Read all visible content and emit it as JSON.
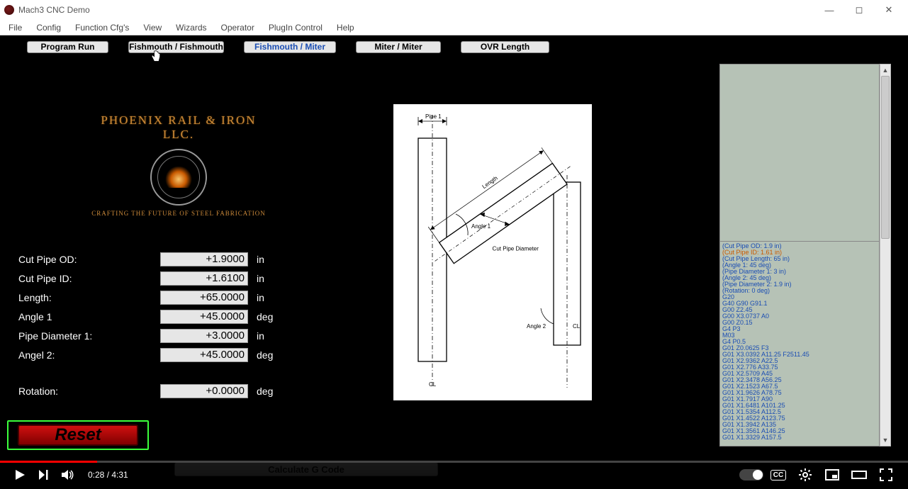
{
  "window": {
    "title": "Mach3 CNC  Demo"
  },
  "menu": [
    "File",
    "Config",
    "Function Cfg's",
    "View",
    "Wizards",
    "Operator",
    "PlugIn Control",
    "Help"
  ],
  "tabs": {
    "t1": "Program Run",
    "t2": "Fishmouth / Fishmouth",
    "t3": "Fishmouth / Miter",
    "t4": "Miter / Miter",
    "t5": "OVR Length"
  },
  "logo": {
    "arc": "PHOENIX RAIL & IRON LLC.",
    "sub": "CRAFTING THE FUTURE OF STEEL FABRICATION"
  },
  "params": {
    "cut_pipe_od": {
      "label": "Cut Pipe OD:",
      "value": "+1.9000",
      "unit": "in"
    },
    "cut_pipe_id": {
      "label": "Cut Pipe ID:",
      "value": "+1.6100",
      "unit": "in"
    },
    "length": {
      "label": "Length:",
      "value": "+65.0000",
      "unit": "in"
    },
    "angle1": {
      "label": "Angle 1",
      "value": "+45.0000",
      "unit": "deg"
    },
    "pipe_dia1": {
      "label": "Pipe Diameter 1:",
      "value": "+3.0000",
      "unit": "in"
    },
    "angle2": {
      "label": "Angel 2:",
      "value": "+45.0000",
      "unit": "deg"
    },
    "rotation": {
      "label": "Rotation:",
      "value": "+0.0000",
      "unit": "deg"
    }
  },
  "buttons": {
    "reset": "Reset",
    "calc": "Calculate G Code"
  },
  "diagram": {
    "pipe1": "Pipe 1",
    "angle1": "Angle 1",
    "length": "Length",
    "cpd": "Cut Pipe Diameter",
    "angle2": "Angle 2",
    "cl1": "CL",
    "cl2": "CL"
  },
  "gcode": [
    "(Cut Pipe OD: 1.9 in)",
    "(Cut Pipe ID: 1.61 in)",
    "(Cut Pipe Length: 65 in)",
    "(Angle 1: 45 deg)",
    "(Pipe Diameter 1: 3 in)",
    "(Angle 2: 45 deg)",
    "(Pipe Diameter 2: 1.9 in)",
    "(Rotation: 0 deg)",
    "G20",
    "G40 G90 G91.1",
    "G00 Z2.45",
    "G00 X3.0737 A0",
    "G00 Z0.15",
    "G4 P3",
    "M03",
    "G4 P0.5",
    "G01 Z0.0625 F3",
    "G01 X3.0392 A11.25 F2511.45",
    "G01 X2.9362 A22.5",
    "G01 X2.776 A33.75",
    "G01 X2.5709 A45",
    "G01 X2.3478 A56.25",
    "G01 X2.1523 A67.5",
    "G01 X1.9626 A78.75",
    "G01 X1.7917 A90",
    "G01 X1.6481 A101.25",
    "G01 X1.5354 A112.5",
    "G01 X1.4522 A123.75",
    "G01 X1.3942 A135",
    "G01 X1.3561 A146.25",
    "G01 X1.3329 A157.5"
  ],
  "gcode_orange_index": 1,
  "player": {
    "time": "0:28 / 4:31",
    "cc": "CC"
  }
}
